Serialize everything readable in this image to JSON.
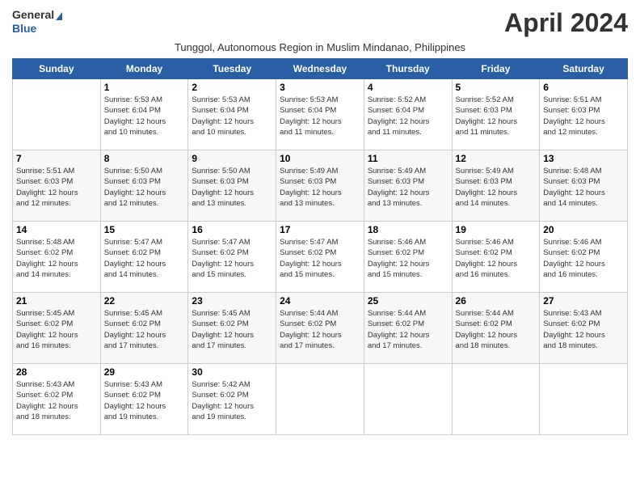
{
  "header": {
    "logo_general": "General",
    "logo_blue": "Blue",
    "month_title": "April 2024",
    "subtitle": "Tunggol, Autonomous Region in Muslim Mindanao, Philippines"
  },
  "calendar": {
    "weekdays": [
      "Sunday",
      "Monday",
      "Tuesday",
      "Wednesday",
      "Thursday",
      "Friday",
      "Saturday"
    ],
    "weeks": [
      [
        {
          "day": "",
          "info": ""
        },
        {
          "day": "1",
          "info": "Sunrise: 5:53 AM\nSunset: 6:04 PM\nDaylight: 12 hours\nand 10 minutes."
        },
        {
          "day": "2",
          "info": "Sunrise: 5:53 AM\nSunset: 6:04 PM\nDaylight: 12 hours\nand 10 minutes."
        },
        {
          "day": "3",
          "info": "Sunrise: 5:53 AM\nSunset: 6:04 PM\nDaylight: 12 hours\nand 11 minutes."
        },
        {
          "day": "4",
          "info": "Sunrise: 5:52 AM\nSunset: 6:04 PM\nDaylight: 12 hours\nand 11 minutes."
        },
        {
          "day": "5",
          "info": "Sunrise: 5:52 AM\nSunset: 6:03 PM\nDaylight: 12 hours\nand 11 minutes."
        },
        {
          "day": "6",
          "info": "Sunrise: 5:51 AM\nSunset: 6:03 PM\nDaylight: 12 hours\nand 12 minutes."
        }
      ],
      [
        {
          "day": "7",
          "info": "Sunrise: 5:51 AM\nSunset: 6:03 PM\nDaylight: 12 hours\nand 12 minutes."
        },
        {
          "day": "8",
          "info": "Sunrise: 5:50 AM\nSunset: 6:03 PM\nDaylight: 12 hours\nand 12 minutes."
        },
        {
          "day": "9",
          "info": "Sunrise: 5:50 AM\nSunset: 6:03 PM\nDaylight: 12 hours\nand 13 minutes."
        },
        {
          "day": "10",
          "info": "Sunrise: 5:49 AM\nSunset: 6:03 PM\nDaylight: 12 hours\nand 13 minutes."
        },
        {
          "day": "11",
          "info": "Sunrise: 5:49 AM\nSunset: 6:03 PM\nDaylight: 12 hours\nand 13 minutes."
        },
        {
          "day": "12",
          "info": "Sunrise: 5:49 AM\nSunset: 6:03 PM\nDaylight: 12 hours\nand 14 minutes."
        },
        {
          "day": "13",
          "info": "Sunrise: 5:48 AM\nSunset: 6:03 PM\nDaylight: 12 hours\nand 14 minutes."
        }
      ],
      [
        {
          "day": "14",
          "info": "Sunrise: 5:48 AM\nSunset: 6:02 PM\nDaylight: 12 hours\nand 14 minutes."
        },
        {
          "day": "15",
          "info": "Sunrise: 5:47 AM\nSunset: 6:02 PM\nDaylight: 12 hours\nand 14 minutes."
        },
        {
          "day": "16",
          "info": "Sunrise: 5:47 AM\nSunset: 6:02 PM\nDaylight: 12 hours\nand 15 minutes."
        },
        {
          "day": "17",
          "info": "Sunrise: 5:47 AM\nSunset: 6:02 PM\nDaylight: 12 hours\nand 15 minutes."
        },
        {
          "day": "18",
          "info": "Sunrise: 5:46 AM\nSunset: 6:02 PM\nDaylight: 12 hours\nand 15 minutes."
        },
        {
          "day": "19",
          "info": "Sunrise: 5:46 AM\nSunset: 6:02 PM\nDaylight: 12 hours\nand 16 minutes."
        },
        {
          "day": "20",
          "info": "Sunrise: 5:46 AM\nSunset: 6:02 PM\nDaylight: 12 hours\nand 16 minutes."
        }
      ],
      [
        {
          "day": "21",
          "info": "Sunrise: 5:45 AM\nSunset: 6:02 PM\nDaylight: 12 hours\nand 16 minutes."
        },
        {
          "day": "22",
          "info": "Sunrise: 5:45 AM\nSunset: 6:02 PM\nDaylight: 12 hours\nand 17 minutes."
        },
        {
          "day": "23",
          "info": "Sunrise: 5:45 AM\nSunset: 6:02 PM\nDaylight: 12 hours\nand 17 minutes."
        },
        {
          "day": "24",
          "info": "Sunrise: 5:44 AM\nSunset: 6:02 PM\nDaylight: 12 hours\nand 17 minutes."
        },
        {
          "day": "25",
          "info": "Sunrise: 5:44 AM\nSunset: 6:02 PM\nDaylight: 12 hours\nand 17 minutes."
        },
        {
          "day": "26",
          "info": "Sunrise: 5:44 AM\nSunset: 6:02 PM\nDaylight: 12 hours\nand 18 minutes."
        },
        {
          "day": "27",
          "info": "Sunrise: 5:43 AM\nSunset: 6:02 PM\nDaylight: 12 hours\nand 18 minutes."
        }
      ],
      [
        {
          "day": "28",
          "info": "Sunrise: 5:43 AM\nSunset: 6:02 PM\nDaylight: 12 hours\nand 18 minutes."
        },
        {
          "day": "29",
          "info": "Sunrise: 5:43 AM\nSunset: 6:02 PM\nDaylight: 12 hours\nand 19 minutes."
        },
        {
          "day": "30",
          "info": "Sunrise: 5:42 AM\nSunset: 6:02 PM\nDaylight: 12 hours\nand 19 minutes."
        },
        {
          "day": "",
          "info": ""
        },
        {
          "day": "",
          "info": ""
        },
        {
          "day": "",
          "info": ""
        },
        {
          "day": "",
          "info": ""
        }
      ]
    ]
  }
}
